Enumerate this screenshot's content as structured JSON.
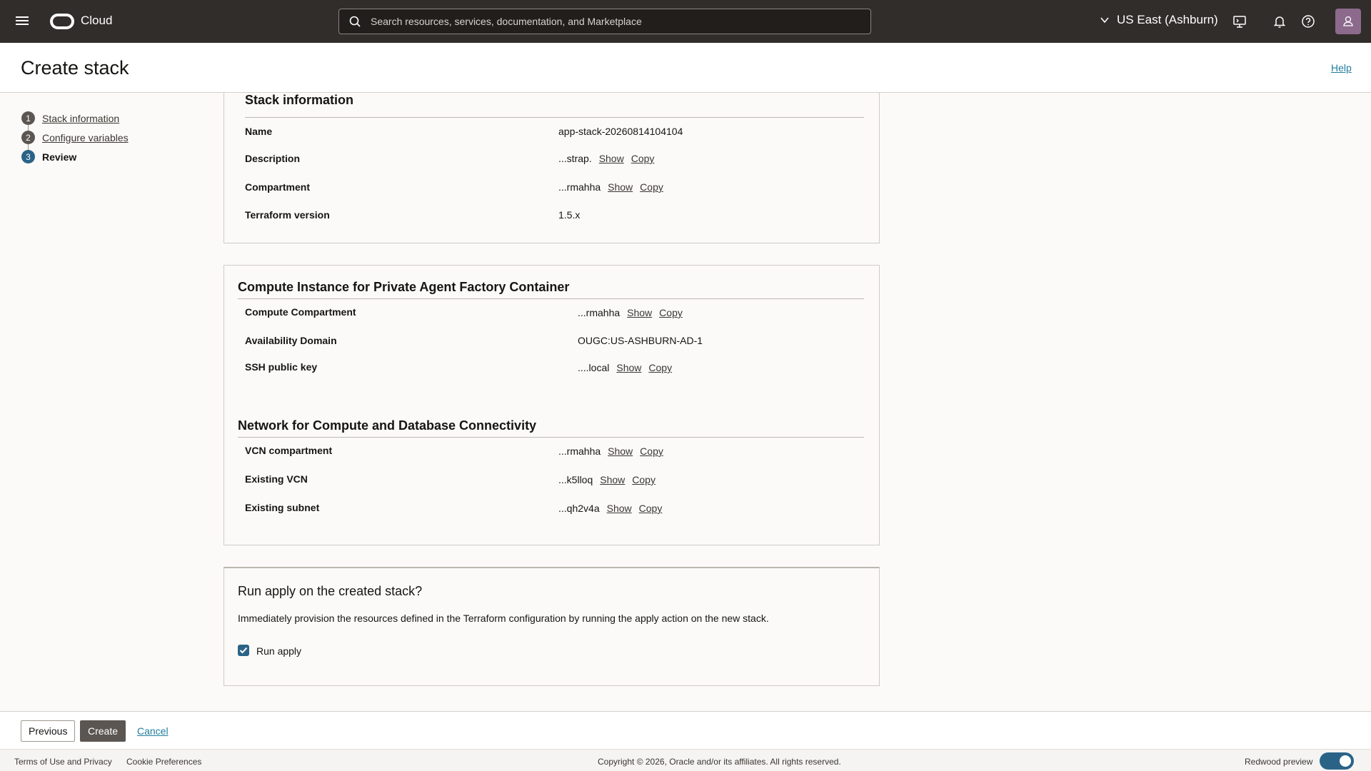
{
  "topbar": {
    "brand": "Cloud",
    "search_placeholder": "Search resources, services, documentation, and Marketplace",
    "region": "US East (Ashburn)"
  },
  "page": {
    "title": "Create stack",
    "help": "Help"
  },
  "steps": [
    {
      "num": "1",
      "label": "Stack information"
    },
    {
      "num": "2",
      "label": "Configure variables"
    },
    {
      "num": "3",
      "label": "Review"
    }
  ],
  "stack_info": {
    "title": "Stack information",
    "rows": [
      {
        "label": "Name",
        "value": "app-stack-20260814104104"
      },
      {
        "label": "Description",
        "value": "...strap.",
        "show": "Show",
        "copy": "Copy"
      },
      {
        "label": "Compartment",
        "value": "...rmahha",
        "show": "Show",
        "copy": "Copy"
      },
      {
        "label": "Terraform version",
        "value": "1.5.x"
      }
    ]
  },
  "compute": {
    "title": "Compute Instance for Private Agent Factory Container",
    "rows": [
      {
        "label": "Compute Compartment",
        "value": "...rmahha",
        "show": "Show",
        "copy": "Copy"
      },
      {
        "label": "Availability Domain",
        "value": "OUGC:US-ASHBURN-AD-1"
      },
      {
        "label": "SSH public key",
        "value": "....local",
        "show": "Show",
        "copy": "Copy"
      }
    ]
  },
  "network": {
    "title": "Network for Compute and Database Connectivity",
    "rows": [
      {
        "label": "VCN compartment",
        "value": "...rmahha",
        "show": "Show",
        "copy": "Copy"
      },
      {
        "label": "Existing VCN",
        "value": "...k5lloq",
        "show": "Show",
        "copy": "Copy"
      },
      {
        "label": "Existing subnet",
        "value": "...qh2v4a",
        "show": "Show",
        "copy": "Copy"
      }
    ]
  },
  "run_apply": {
    "title": "Run apply on the created stack?",
    "description": "Immediately provision the resources defined in the Terraform configuration by running the apply action on the new stack.",
    "checkbox_label": "Run apply",
    "checked": true
  },
  "actions": {
    "previous": "Previous",
    "create": "Create",
    "cancel": "Cancel"
  },
  "footer": {
    "terms": "Terms of Use and Privacy",
    "cookies": "Cookie Preferences",
    "copyright": "Copyright © 2026, Oracle and/or its affiliates. All rights reserved.",
    "redwood": "Redwood preview",
    "redwood_on": true
  },
  "colors": {
    "topbar": "#312d2a",
    "accent": "#2b6387",
    "link": "#227e9e"
  }
}
